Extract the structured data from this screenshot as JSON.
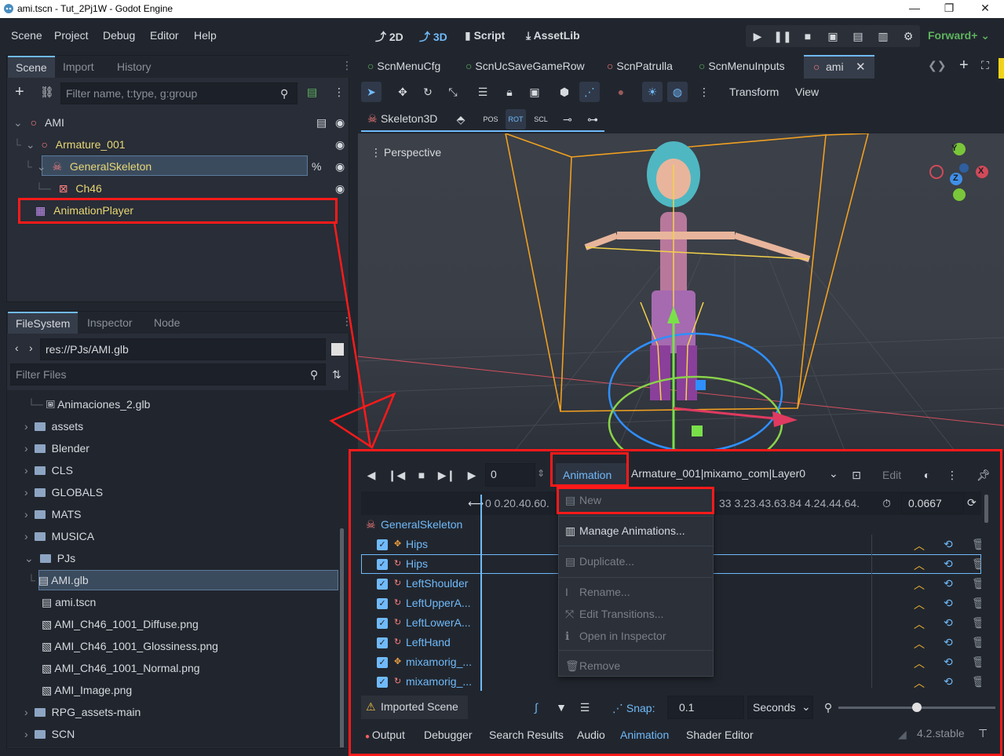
{
  "window": {
    "title": "ami.tscn - Tut_2Pj1W - Godot Engine",
    "min": "—",
    "max": "❐",
    "close": "✕"
  },
  "menu": {
    "items": [
      "Scene",
      "Project",
      "Debug",
      "Editor",
      "Help"
    ]
  },
  "modes": {
    "m2d": "2D",
    "m3d": "3D",
    "script": "Script",
    "assetlib": "AssetLib"
  },
  "renderer": "Forward+",
  "scene_dock": {
    "tabs": [
      "Scene",
      "Import",
      "History"
    ],
    "filter_placeholder": "Filter name, t:type, g:group",
    "nodes": [
      {
        "name": "AMI",
        "color": "#d6d9de"
      },
      {
        "name": "Armature_001",
        "color": "#e8d774"
      },
      {
        "name": "GeneralSkeleton",
        "color": "#e8d774"
      },
      {
        "name": "Ch46",
        "color": "#e8d774"
      },
      {
        "name": "AnimationPlayer",
        "color": "#e8d774"
      }
    ]
  },
  "fs_dock": {
    "tabs": [
      "FileSystem",
      "Inspector",
      "Node"
    ],
    "path": "res://PJs/AMI.glb",
    "filter_placeholder": "Filter Files",
    "items": [
      "Animaciones_2.glb",
      "assets",
      "Blender",
      "CLS",
      "GLOBALS",
      "MATS",
      "MUSICA",
      "PJs",
      "AMI.glb",
      "ami.tscn",
      "AMI_Ch46_1001_Diffuse.png",
      "AMI_Ch46_1001_Glossiness.png",
      "AMI_Ch46_1001_Normal.png",
      "AMI_Image.png",
      "RPG_assets-main",
      "SCN"
    ]
  },
  "editor_tabs": [
    "ScnMenuCfg",
    "ScnUcSaveGameRow",
    "ScnPatrulla",
    "ScnMenuInputs",
    "ami"
  ],
  "viewport": {
    "menus": {
      "transform": "Transform",
      "view": "View"
    },
    "skeleton_btn": "Skeleton3D",
    "skeleton_icons": [
      "POS",
      "ROT",
      "SCL"
    ],
    "perspective": "Perspective",
    "gizmo": {
      "x": "X",
      "y": "Y",
      "z": "Z"
    }
  },
  "animation": {
    "frame": "0",
    "menu_button": "Animation",
    "current": "Armature_001|mixamo_com|Layer0",
    "edit": "Edit",
    "ruler_left": "0  0.20.40.60.",
    "ruler_right": "33  3.23.43.63.84  4.24.44.64.",
    "step": "0.0667",
    "root": "GeneralSkeleton",
    "tracks": [
      "Hips",
      "Hips",
      "LeftShoulder",
      "LeftUpperA...",
      "LeftLowerA...",
      "LeftHand",
      "mixamorig_...",
      "mixamorig_..."
    ],
    "imported": "Imported Scene",
    "snap_label": "Snap:",
    "snap_value": "0.1",
    "snap_unit": "Seconds",
    "dropdown": [
      "New",
      "Manage Animations...",
      "Duplicate...",
      "Rename...",
      "Edit Transitions...",
      "Open in Inspector",
      "Remove"
    ]
  },
  "bottom_tabs": [
    "Output",
    "Debugger",
    "Search Results",
    "Audio",
    "Animation",
    "Shader Editor"
  ],
  "version": "4.2.stable"
}
